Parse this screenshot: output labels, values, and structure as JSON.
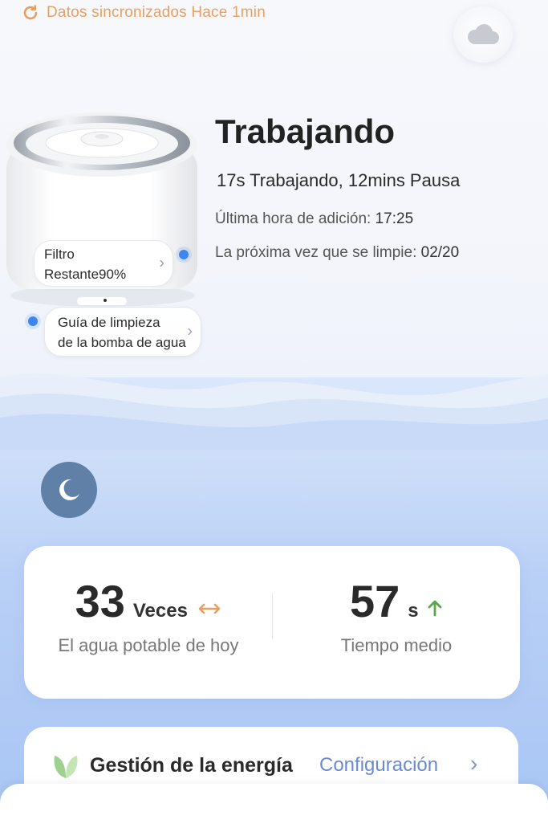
{
  "sync": {
    "text": "Datos sincronizados Hace 1min"
  },
  "status": {
    "title": "Trabajando",
    "summary": "17s Trabajando, 12mins Pausa",
    "last_add_label": "Última hora de adición:",
    "last_add_value": "17:25",
    "next_clean_label": "La próxima vez que se limpie:",
    "next_clean_value": "02/20"
  },
  "tags": {
    "filter_line1": "Filtro",
    "filter_line2": "Restante90%",
    "guide_line1": "Guía de limpieza",
    "guide_line2": "de la bomba de agua"
  },
  "stats": {
    "drinks_value": "33",
    "drinks_unit": "Veces",
    "drinks_label": "El agua potable de hoy",
    "avg_value": "57",
    "avg_unit": "s",
    "avg_label": "Tiempo medio"
  },
  "energy": {
    "title": "Gestión de la energía",
    "link": "Configuración"
  },
  "colors": {
    "accent_orange": "#e8a062",
    "link_blue": "#6a8ad0",
    "trend_up_green": "#5aa64a",
    "moon_button": "#6080a8"
  },
  "icons": [
    "refresh-icon",
    "cloud-icon",
    "moon-icon",
    "leaf-icon",
    "chevron-right-icon",
    "horizontal-arrows-icon",
    "arrow-up-icon"
  ]
}
